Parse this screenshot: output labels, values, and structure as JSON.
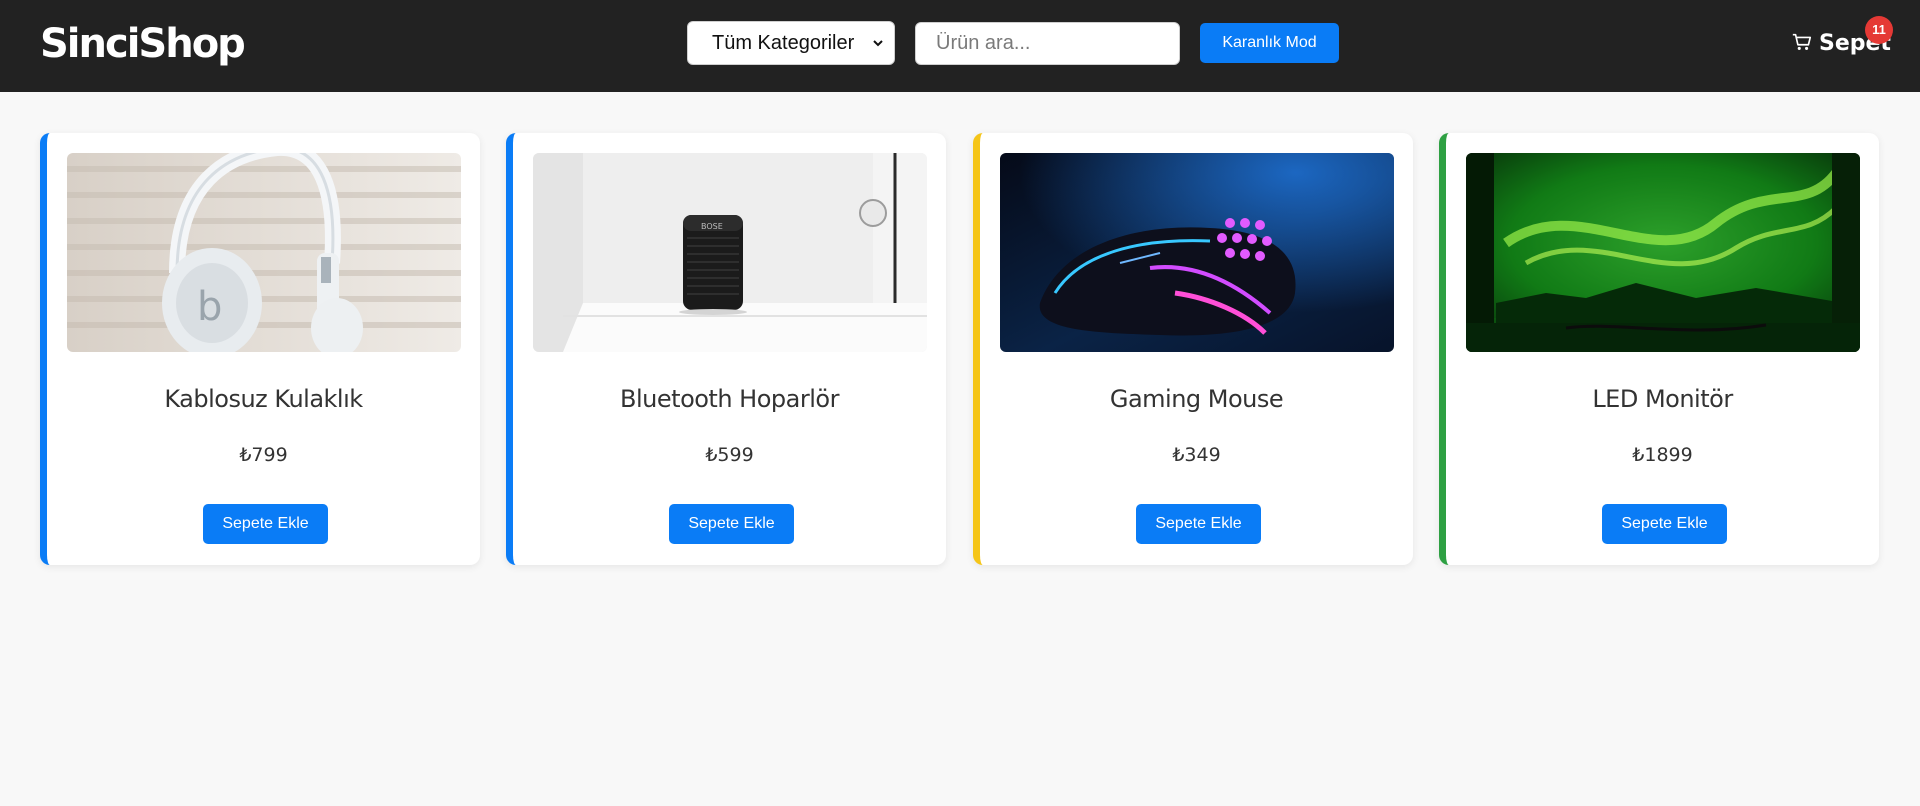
{
  "header": {
    "logo": "SinciShop",
    "category_select": {
      "selected": "Tüm Kategoriler"
    },
    "search": {
      "placeholder": "Ürün ara...",
      "value": ""
    },
    "dark_mode_label": "Karanlık Mod",
    "cart": {
      "label": "Sepet",
      "count": "11",
      "icon": "shopping-cart-icon"
    }
  },
  "products": [
    {
      "name": "Kablosuz Kulaklık",
      "price": "₺799",
      "button": "Sepete Ekle",
      "accent": "#0a7cf6",
      "image": "white-headphones-photo"
    },
    {
      "name": "Bluetooth Hoparlör",
      "price": "₺599",
      "button": "Sepete Ekle",
      "accent": "#0a7cf6",
      "image": "black-speaker-photo"
    },
    {
      "name": "Gaming Mouse",
      "price": "₺349",
      "button": "Sepete Ekle",
      "accent": "#f5c518",
      "image": "rgb-gaming-mouse-photo"
    },
    {
      "name": "LED Monitör",
      "price": "₺1899",
      "button": "Sepete Ekle",
      "accent": "#2ea043",
      "image": "green-aurora-monitor-photo"
    }
  ],
  "colors": {
    "header_bg": "#222222",
    "primary": "#0a7cf6",
    "badge": "#e53935",
    "page_bg": "#f8f8f8"
  }
}
